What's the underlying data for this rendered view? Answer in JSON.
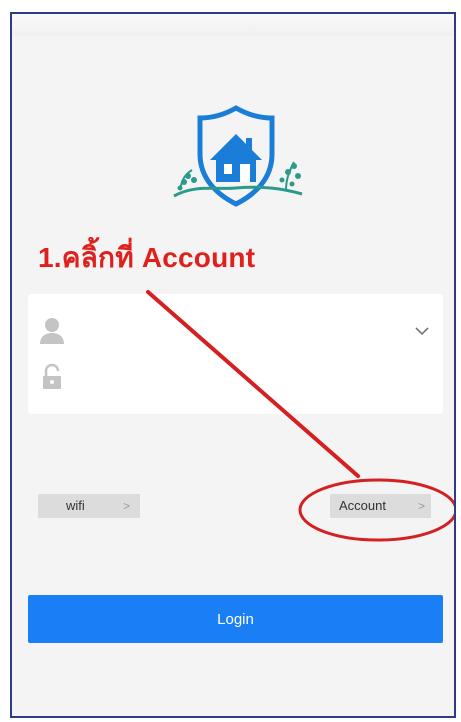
{
  "annotation": {
    "text": "1.คลิ้กที่ Account",
    "color": "#e0201c"
  },
  "login_form": {
    "username_value": "",
    "password_value": ""
  },
  "icons": {
    "logo": "house-shield-logo-icon",
    "user": "user-icon",
    "lock": "lock-icon",
    "dropdown": "chevron-down-icon",
    "caret": "chevron-right-icon"
  },
  "links": {
    "wifi_label": "wifi",
    "account_label": "Account",
    "caret": ">"
  },
  "login_button": {
    "label": "Login"
  },
  "colors": {
    "accent": "#1a7ef5",
    "annotation": "#e0201c",
    "logo": "#1a7ed8",
    "foliage": "#2a9a8a"
  }
}
